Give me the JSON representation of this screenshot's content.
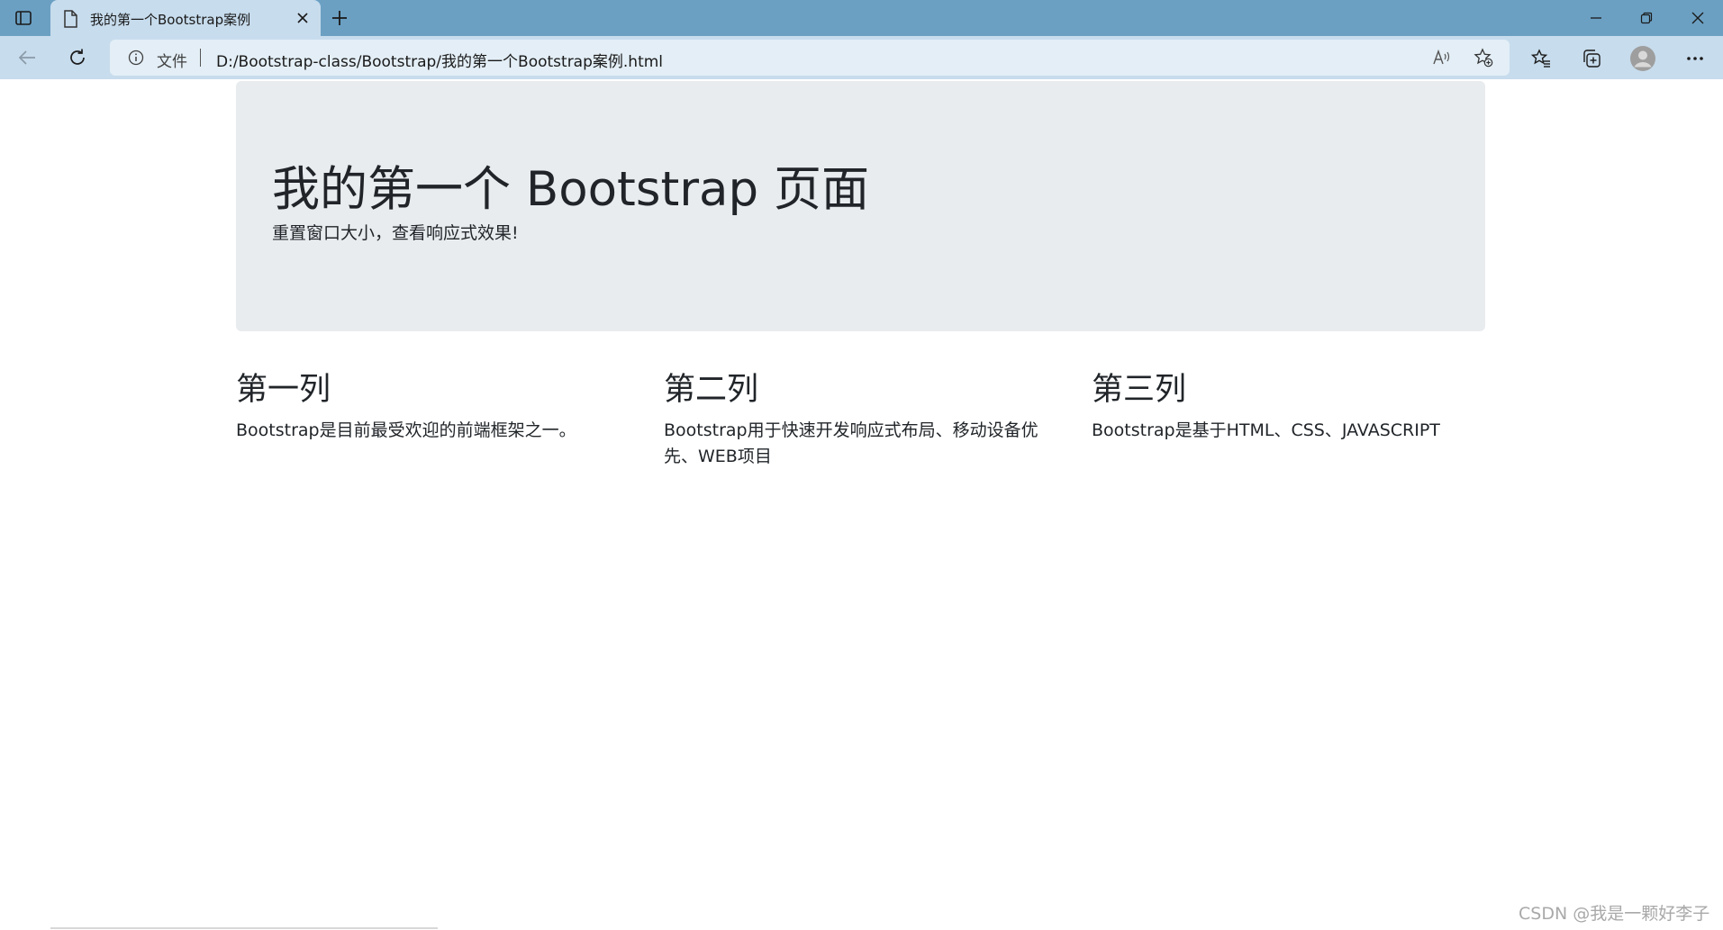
{
  "browser": {
    "tab": {
      "title": "我的第一个Bootstrap案例"
    },
    "address_bar": {
      "protocol_label": "文件",
      "url": "D:/Bootstrap-class/Bootstrap/我的第一个Bootstrap案例.html"
    },
    "icons": {
      "tab_actions": "tab-actions-icon",
      "favicon": "document-icon",
      "tab_close": "close-icon",
      "new_tab": "plus-icon",
      "back": "arrow-left-icon",
      "reload": "reload-icon",
      "info": "info-icon",
      "read_aloud": "read-aloud-icon",
      "add_favorite": "star-add-icon",
      "favorites": "favorites-icon",
      "collections": "collections-icon",
      "profile": "profile-icon",
      "more": "more-icon"
    },
    "colors": {
      "titlebar": "#6ba0c3",
      "toolbar": "#c7dced",
      "addressbar": "#e3eef6"
    }
  },
  "page": {
    "jumbotron": {
      "title": "我的第一个 Bootstrap 页面",
      "subtitle": "重置窗口大小，查看响应式效果!"
    },
    "columns": [
      {
        "title": "第一列",
        "text": "Bootstrap是目前最受欢迎的前端框架之一。"
      },
      {
        "title": "第二列",
        "text": "Bootstrap用于快速开发响应式布局、移动设备优先、WEB项目"
      },
      {
        "title": "第三列",
        "text": "Bootstrap是基于HTML、CSS、JAVASCRIPT"
      }
    ],
    "colors": {
      "jumbotron_bg": "#e9ecef",
      "text": "#212529"
    }
  },
  "watermark": "CSDN @我是一颗好李子"
}
